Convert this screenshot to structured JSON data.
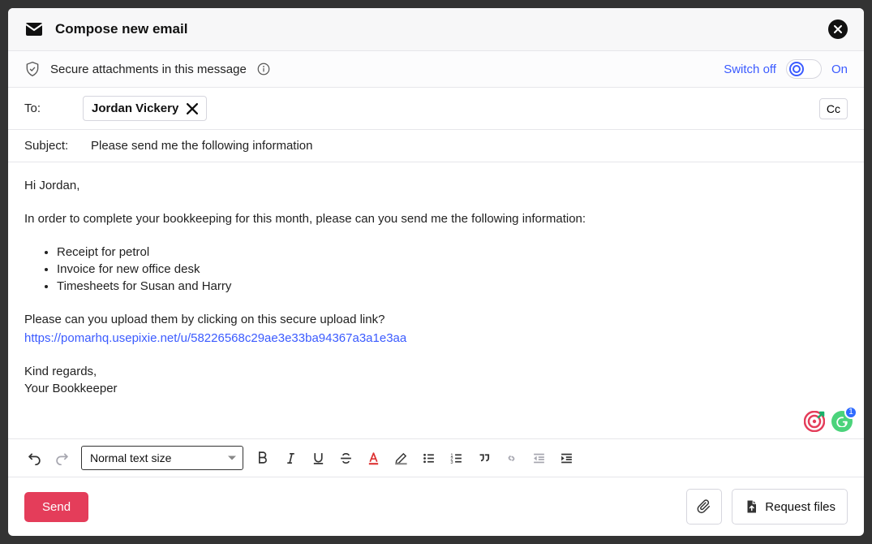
{
  "header": {
    "title": "Compose new email"
  },
  "secure": {
    "message": "Secure attachments in this message",
    "switch_off_label": "Switch off",
    "on_label": "On"
  },
  "to": {
    "label": "To:",
    "recipient_name": "Jordan Vickery",
    "cc_label": "Cc"
  },
  "subject": {
    "label": "Subject:",
    "value": "Please send me the following information"
  },
  "body": {
    "greeting": "Hi Jordan,",
    "intro": "In order to complete your bookkeeping for this month, please can you send me the following information:",
    "list": [
      "Receipt for petrol",
      "Invoice for new office desk",
      "Timesheets for Susan and Harry"
    ],
    "upload_prompt": "Please can you upload them by clicking on this secure upload link?",
    "upload_link": "https://pomarhq.usepixie.net/u/58226568c29ae3e33ba94367a3a1e3aa",
    "sig_line1": "Kind regards,",
    "sig_line2": "Your Bookkeeper"
  },
  "floating": {
    "grammar_count": "1"
  },
  "toolbar": {
    "font_size_label": "Normal text size"
  },
  "footer": {
    "send_label": "Send",
    "request_files_label": "Request files"
  },
  "colors": {
    "accent_red": "#e43d5a",
    "link_blue": "#3b5bff"
  }
}
